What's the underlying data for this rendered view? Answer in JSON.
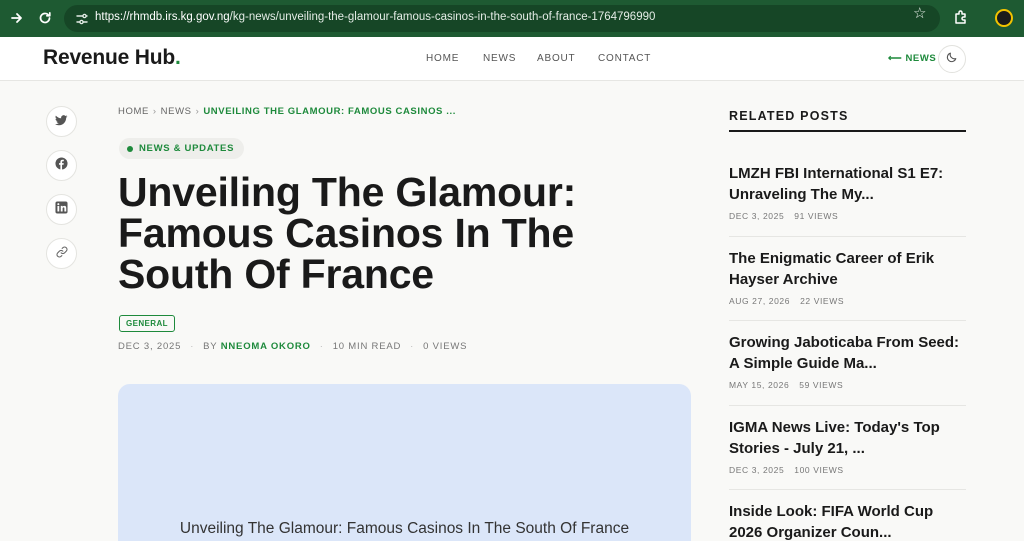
{
  "browser": {
    "url_host": "https://rhmdb.irs.kg.gov.ng",
    "url_path": "/kg-news/unveiling-the-glamour-famous-casinos-in-the-south-of-france-1764796990"
  },
  "header": {
    "logo": "Revenue Hub",
    "logo_dot": ".",
    "menu": [
      "HOME",
      "NEWS",
      "ABOUT",
      "CONTACT"
    ],
    "news_link": "⟵ NEWS"
  },
  "share": [
    "twitter-icon",
    "facebook-icon",
    "linkedin-icon",
    "link-icon"
  ],
  "breadcrumb": {
    "home": "HOME",
    "news": "NEWS",
    "current": "UNVEILING THE GLAMOUR: FAMOUS CASINOS ..."
  },
  "article": {
    "category": "NEWS & UPDATES",
    "title": "Unveiling The Glamour: Famous Casinos In The South Of France",
    "tag": "GENERAL",
    "date": "DEC 3, 2025",
    "by": "BY",
    "author": "NNEOMA OKORO",
    "read_time": "10 MIN READ",
    "views": "0 VIEWS",
    "hero_caption": "Unveiling The Glamour: Famous Casinos In The South Of France"
  },
  "sidebar": {
    "heading": "RELATED POSTS",
    "posts": [
      {
        "title": "LMZH FBI International S1 E7: Unraveling The My...",
        "date": "DEC 3, 2025",
        "views": "91 VIEWS"
      },
      {
        "title": "The Enigmatic Career of Erik Hayser Archive",
        "date": "AUG 27, 2026",
        "views": "22 VIEWS"
      },
      {
        "title": "Growing Jaboticaba From Seed: A Simple Guide Ma...",
        "date": "MAY 15, 2026",
        "views": "59 VIEWS"
      },
      {
        "title": "IGMA News Live: Today's Top Stories - July 21, ...",
        "date": "DEC 3, 2025",
        "views": "100 VIEWS"
      },
      {
        "title": "Inside Look: FIFA World Cup 2026 Organizer Coun...",
        "date": "",
        "views": ""
      }
    ]
  },
  "colors": {
    "accent": "#1e8a3c",
    "browser_bar": "#1e5a32",
    "hero_bg": "#dbe6f9"
  }
}
